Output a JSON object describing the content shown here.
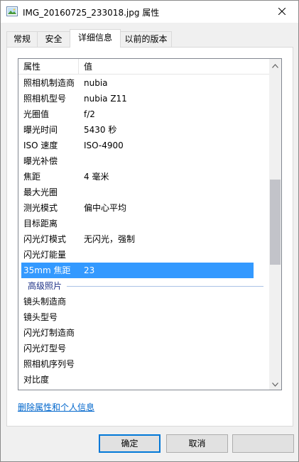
{
  "window": {
    "title": "IMG_20160725_233018.jpg 属性"
  },
  "tabs": [
    {
      "label": "常规"
    },
    {
      "label": "安全"
    },
    {
      "label": "详细信息"
    },
    {
      "label": "以前的版本"
    }
  ],
  "list": {
    "header": {
      "col1": "属性",
      "col2": "值"
    },
    "rows": [
      {
        "name": "照相机制造商",
        "value": "nubia"
      },
      {
        "name": "照相机型号",
        "value": "nubia Z11"
      },
      {
        "name": "光圈值",
        "value": "f/2"
      },
      {
        "name": "曝光时间",
        "value": "5430 秒"
      },
      {
        "name": "ISO 速度",
        "value": "ISO-4900"
      },
      {
        "name": "曝光补偿",
        "value": ""
      },
      {
        "name": "焦距",
        "value": "4 毫米"
      },
      {
        "name": "最大光圈",
        "value": ""
      },
      {
        "name": "测光模式",
        "value": "偏中心平均"
      },
      {
        "name": "目标距离",
        "value": ""
      },
      {
        "name": "闪光灯模式",
        "value": "无闪光，强制"
      },
      {
        "name": "闪光灯能量",
        "value": ""
      },
      {
        "name": "35mm 焦距",
        "value": "23",
        "selected": true
      }
    ],
    "group_label": "高级照片",
    "rows2": [
      {
        "name": "镜头制造商",
        "value": ""
      },
      {
        "name": "镜头型号",
        "value": ""
      },
      {
        "name": "闪光灯制造商",
        "value": ""
      },
      {
        "name": "闪光灯型号",
        "value": ""
      },
      {
        "name": "照相机序列号",
        "value": ""
      },
      {
        "name": "对比度",
        "value": ""
      }
    ]
  },
  "remove_link": "删除属性和个人信息",
  "buttons": {
    "ok": "确定",
    "cancel": "取消",
    "apply": ""
  },
  "colors": {
    "selection": "#3399ff",
    "link": "#0066cc",
    "accent_border": "#0078d7"
  }
}
